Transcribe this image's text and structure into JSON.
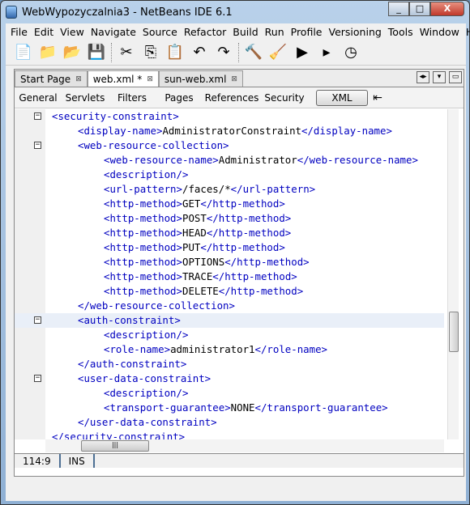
{
  "window": {
    "title": "WebWypozyczalnia3 - NetBeans IDE 6.1",
    "min": "_",
    "max": "□",
    "close": "X"
  },
  "menu": [
    "File",
    "Edit",
    "View",
    "Navigate",
    "Source",
    "Refactor",
    "Build",
    "Run",
    "Profile",
    "Versioning",
    "Tools",
    "Window",
    "Help"
  ],
  "toolbar": [
    {
      "name": "new-file-icon",
      "g": "📄"
    },
    {
      "name": "new-project-icon",
      "g": "📁"
    },
    {
      "name": "open-project-icon",
      "g": "📂"
    },
    {
      "name": "save-all-icon",
      "g": "💾"
    },
    {
      "sep": true
    },
    {
      "name": "cut-icon",
      "g": "✂"
    },
    {
      "name": "copy-icon",
      "g": "⎘"
    },
    {
      "name": "paste-icon",
      "g": "📋"
    },
    {
      "name": "undo-icon",
      "g": "↶"
    },
    {
      "name": "redo-icon",
      "g": "↷"
    },
    {
      "sep": true
    },
    {
      "name": "build-icon",
      "g": "🔨"
    },
    {
      "name": "clean-build-icon",
      "g": "🧹"
    },
    {
      "name": "run-icon",
      "g": "▶"
    },
    {
      "name": "debug-icon",
      "g": "▸"
    },
    {
      "name": "profile-icon",
      "g": "◷"
    }
  ],
  "tabs": [
    {
      "label": "Start Page",
      "active": false
    },
    {
      "label": "web.xml *",
      "active": true
    },
    {
      "label": "sun-web.xml",
      "active": false
    }
  ],
  "subtabs": [
    "General",
    "Servlets",
    "Filters",
    "Pages",
    "References",
    "Security",
    "XML"
  ],
  "code": [
    {
      "i": 0,
      "f": "-",
      "p": [
        [
          "t",
          "<security-constraint>"
        ]
      ]
    },
    {
      "i": 1,
      "p": [
        [
          "t",
          "<display-name>"
        ],
        [
          "x",
          "AdministratorConstraint"
        ],
        [
          "t",
          "</display-name>"
        ]
      ]
    },
    {
      "i": 1,
      "f": "-",
      "p": [
        [
          "t",
          "<web-resource-collection>"
        ]
      ]
    },
    {
      "i": 2,
      "p": [
        [
          "t",
          "<web-resource-name>"
        ],
        [
          "x",
          "Administrator"
        ],
        [
          "t",
          "</web-resource-name>"
        ]
      ]
    },
    {
      "i": 2,
      "p": [
        [
          "t",
          "<description/>"
        ]
      ]
    },
    {
      "i": 2,
      "p": [
        [
          "t",
          "<url-pattern>"
        ],
        [
          "x",
          "/faces/*"
        ],
        [
          "t",
          "</url-pattern>"
        ]
      ]
    },
    {
      "i": 2,
      "p": [
        [
          "t",
          "<http-method>"
        ],
        [
          "x",
          "GET"
        ],
        [
          "t",
          "</http-method>"
        ]
      ]
    },
    {
      "i": 2,
      "p": [
        [
          "t",
          "<http-method>"
        ],
        [
          "x",
          "POST"
        ],
        [
          "t",
          "</http-method>"
        ]
      ]
    },
    {
      "i": 2,
      "p": [
        [
          "t",
          "<http-method>"
        ],
        [
          "x",
          "HEAD"
        ],
        [
          "t",
          "</http-method>"
        ]
      ]
    },
    {
      "i": 2,
      "p": [
        [
          "t",
          "<http-method>"
        ],
        [
          "x",
          "PUT"
        ],
        [
          "t",
          "</http-method>"
        ]
      ]
    },
    {
      "i": 2,
      "p": [
        [
          "t",
          "<http-method>"
        ],
        [
          "x",
          "OPTIONS"
        ],
        [
          "t",
          "</http-method>"
        ]
      ]
    },
    {
      "i": 2,
      "p": [
        [
          "t",
          "<http-method>"
        ],
        [
          "x",
          "TRACE"
        ],
        [
          "t",
          "</http-method>"
        ]
      ]
    },
    {
      "i": 2,
      "p": [
        [
          "t",
          "<http-method>"
        ],
        [
          "x",
          "DELETE"
        ],
        [
          "t",
          "</http-method>"
        ]
      ]
    },
    {
      "i": 1,
      "p": [
        [
          "t",
          "</web-resource-collection>"
        ]
      ]
    },
    {
      "i": 1,
      "f": "-",
      "cur": true,
      "p": [
        [
          "t",
          "<auth-constraint>"
        ]
      ]
    },
    {
      "i": 2,
      "p": [
        [
          "t",
          "<description/>"
        ]
      ]
    },
    {
      "i": 2,
      "p": [
        [
          "t",
          "<role-name>"
        ],
        [
          "x",
          "administrator1"
        ],
        [
          "t",
          "</role-name>"
        ]
      ]
    },
    {
      "i": 1,
      "p": [
        [
          "t",
          "</auth-constraint>"
        ]
      ]
    },
    {
      "i": 1,
      "f": "-",
      "p": [
        [
          "t",
          "<user-data-constraint>"
        ]
      ]
    },
    {
      "i": 2,
      "p": [
        [
          "t",
          "<description/>"
        ]
      ]
    },
    {
      "i": 2,
      "p": [
        [
          "t",
          "<transport-guarantee>"
        ],
        [
          "x",
          "NONE"
        ],
        [
          "t",
          "</transport-guarantee>"
        ]
      ]
    },
    {
      "i": 1,
      "p": [
        [
          "t",
          "</user-data-constraint>"
        ]
      ]
    },
    {
      "i": 0,
      "p": [
        [
          "t",
          "</security-constraint>"
        ]
      ]
    }
  ],
  "status": {
    "position": "114:9",
    "mode": "INS"
  }
}
